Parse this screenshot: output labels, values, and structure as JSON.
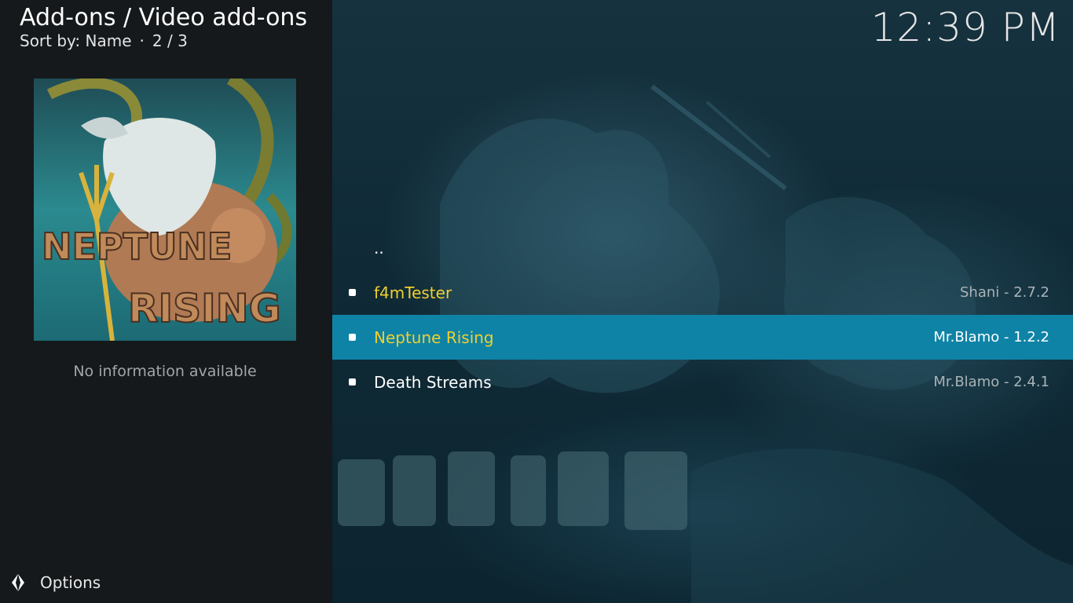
{
  "header": {
    "title": "Add-ons / Video add-ons",
    "sort_label": "Sort by: Name",
    "separator": "·",
    "page": "2 / 3"
  },
  "clock": "12:39 PM",
  "info_panel": {
    "artwork_icon": "neptune-rising-artwork",
    "no_info": "No information available"
  },
  "options": {
    "icon": "options-icon",
    "label": "Options"
  },
  "list": {
    "parent": "..",
    "items": [
      {
        "name": "f4mTester",
        "meta": "Shani - 2.7.2",
        "selected": false
      },
      {
        "name": "Neptune Rising",
        "meta": "Mr.Blamo - 1.2.2",
        "selected": true
      },
      {
        "name": "Death Streams",
        "meta": "Mr.Blamo - 2.4.1",
        "selected": false
      }
    ]
  },
  "colors": {
    "selection": "#0e83a6",
    "highlight_text": "#f0cf2f",
    "panel": "#15191c"
  }
}
